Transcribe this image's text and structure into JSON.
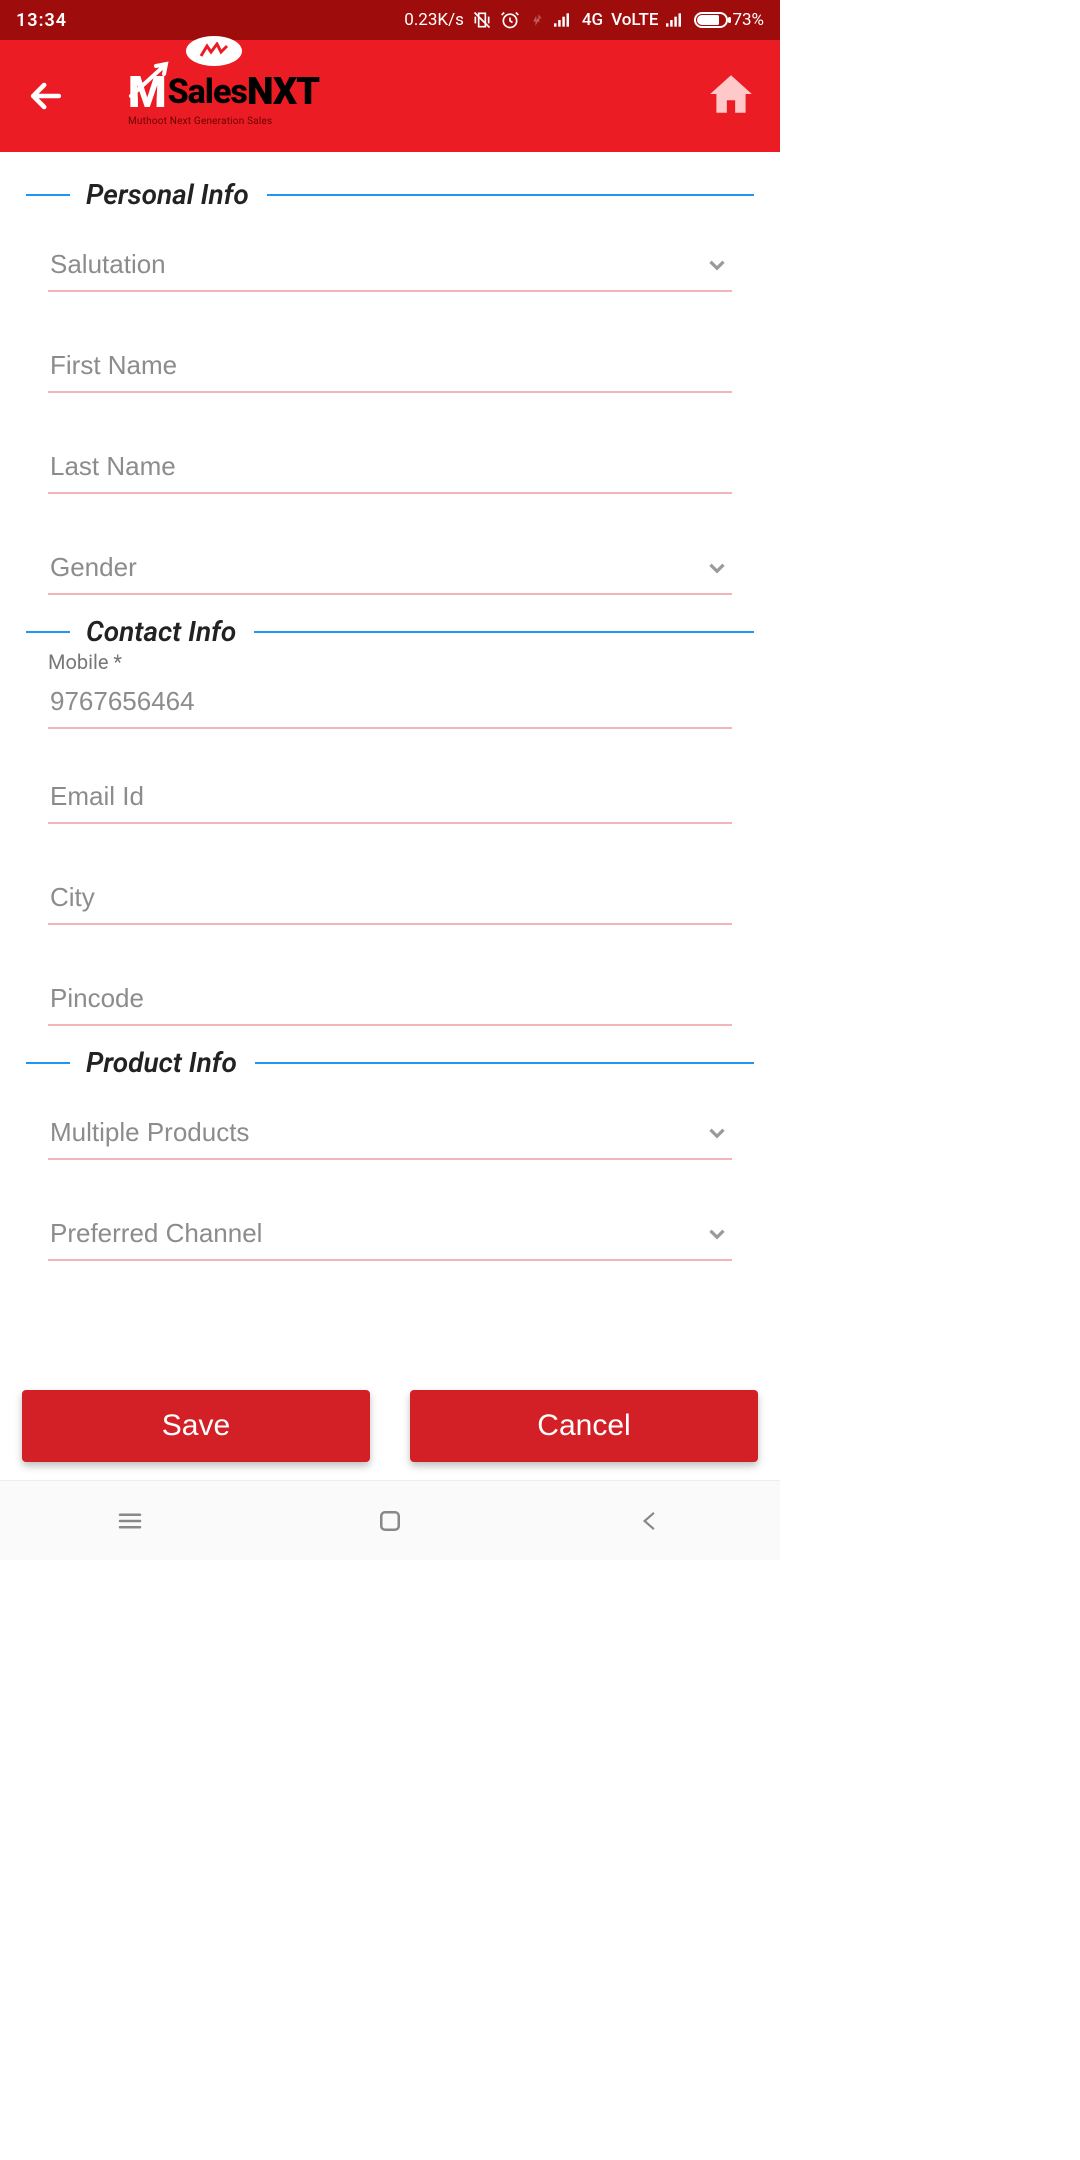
{
  "status": {
    "time": "13:34",
    "netspeed": "0.23K/s",
    "network_label": "4G",
    "volte_label": "VoLTE",
    "battery_pct": "73%"
  },
  "header": {
    "logo_text_sales": "Sales",
    "logo_text_nxt": "NXT",
    "logo_subtitle": "Muthoot Next Generation Sales"
  },
  "sections": {
    "personal": {
      "title": "Personal Info"
    },
    "contact": {
      "title": "Contact Info"
    },
    "product": {
      "title": "Product Info"
    }
  },
  "fields": {
    "salutation": {
      "placeholder": "Salutation",
      "value": ""
    },
    "first_name": {
      "placeholder": "First Name",
      "value": ""
    },
    "last_name": {
      "placeholder": "Last Name",
      "value": ""
    },
    "gender": {
      "placeholder": "Gender",
      "value": ""
    },
    "mobile": {
      "label": "Mobile *",
      "placeholder": "9767656464",
      "value": ""
    },
    "email": {
      "placeholder": "Email Id",
      "value": ""
    },
    "city": {
      "placeholder": "City",
      "value": ""
    },
    "pincode": {
      "placeholder": "Pincode",
      "value": ""
    },
    "multiple_products": {
      "placeholder": "Multiple Products",
      "value": ""
    },
    "preferred_channel": {
      "placeholder": "Preferred Channel",
      "value": ""
    }
  },
  "buttons": {
    "save": "Save",
    "cancel": "Cancel"
  }
}
